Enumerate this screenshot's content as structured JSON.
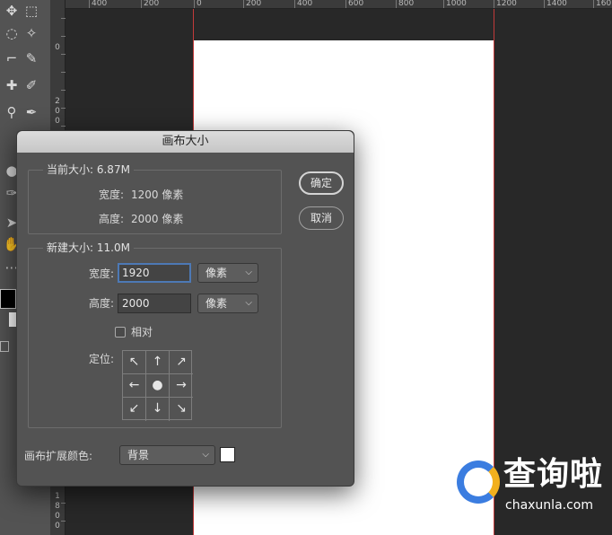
{
  "ruler": {
    "top": [
      "400",
      "200",
      "0",
      "200",
      "400",
      "600",
      "800",
      "1000",
      "1200",
      "1400",
      "160"
    ],
    "left": [
      "0",
      "2",
      "0",
      "0",
      "1",
      "8",
      "0",
      "0"
    ]
  },
  "dialog": {
    "title": "画布大小",
    "current": {
      "title": "当前大小: 6.87M",
      "width_label": "宽度:",
      "width_value": "1200 像素",
      "height_label": "高度:",
      "height_value": "2000 像素"
    },
    "new": {
      "title": "新建大小: 11.0M",
      "width_label": "宽度:",
      "width_value": "1920",
      "width_unit": "像素",
      "height_label": "高度:",
      "height_value": "2000",
      "height_unit": "像素",
      "relative_label": "相对",
      "anchor_label": "定位:"
    },
    "ok": "确定",
    "cancel": "取消",
    "ext_color_label": "画布扩展颜色:",
    "ext_color_value": "背景"
  },
  "watermark": {
    "text": "查询啦",
    "url": "chaxunla.com"
  },
  "colors": {
    "canvas": "#ffffff",
    "guide": "#c23a3a",
    "focus": "#4d79b5"
  }
}
